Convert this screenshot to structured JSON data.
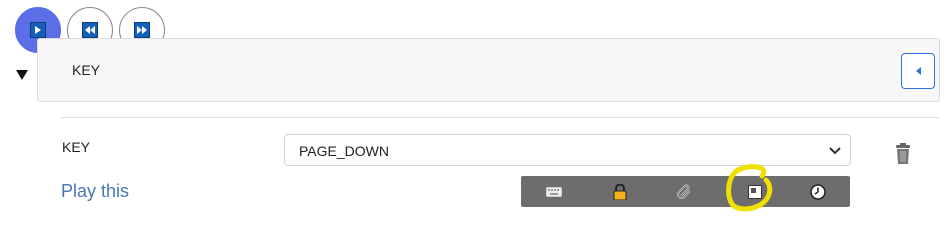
{
  "player": {
    "play_icon": "play-icon",
    "rewind_icon": "rewind-icon",
    "fast_forward_icon": "fast-forward-icon"
  },
  "panel": {
    "title": "KEY",
    "toggle_icon": "caret-down-icon",
    "collapse_icon": "caret-left-icon"
  },
  "row": {
    "label": "KEY",
    "select_value": "PAGE_DOWN",
    "delete_icon": "trash-icon"
  },
  "play_link": "Play this",
  "toolbar": {
    "items": [
      "keyboard-icon",
      "lock-icon",
      "paperclip-icon",
      "screenshot-icon",
      "clock-icon"
    ]
  },
  "colors": {
    "primary": "#5b6ee8",
    "link": "#4a76b8",
    "toolbar_bg": "#6d6d6d",
    "highlight": "#f0e000"
  }
}
